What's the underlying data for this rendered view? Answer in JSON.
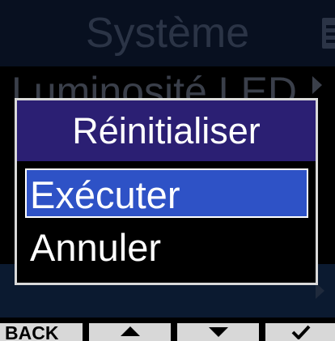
{
  "header": {
    "title": "Système",
    "battery_icon": "battery-icon"
  },
  "background_menu": {
    "item_label": "Luminosité LED"
  },
  "dialog": {
    "title": "Réinitialiser",
    "options": [
      {
        "label": "Exécuter",
        "selected": true
      },
      {
        "label": "Annuler",
        "selected": false
      }
    ]
  },
  "softkeys": {
    "back_label": "BACK",
    "up_icon": "triangle-up-icon",
    "down_icon": "triangle-down-icon",
    "ok_icon": "checkmark-icon"
  },
  "colors": {
    "dialog_title_bg": "#2b1f73",
    "selection": "#2e52c6",
    "softkey_bg": "#d8d8d8"
  }
}
